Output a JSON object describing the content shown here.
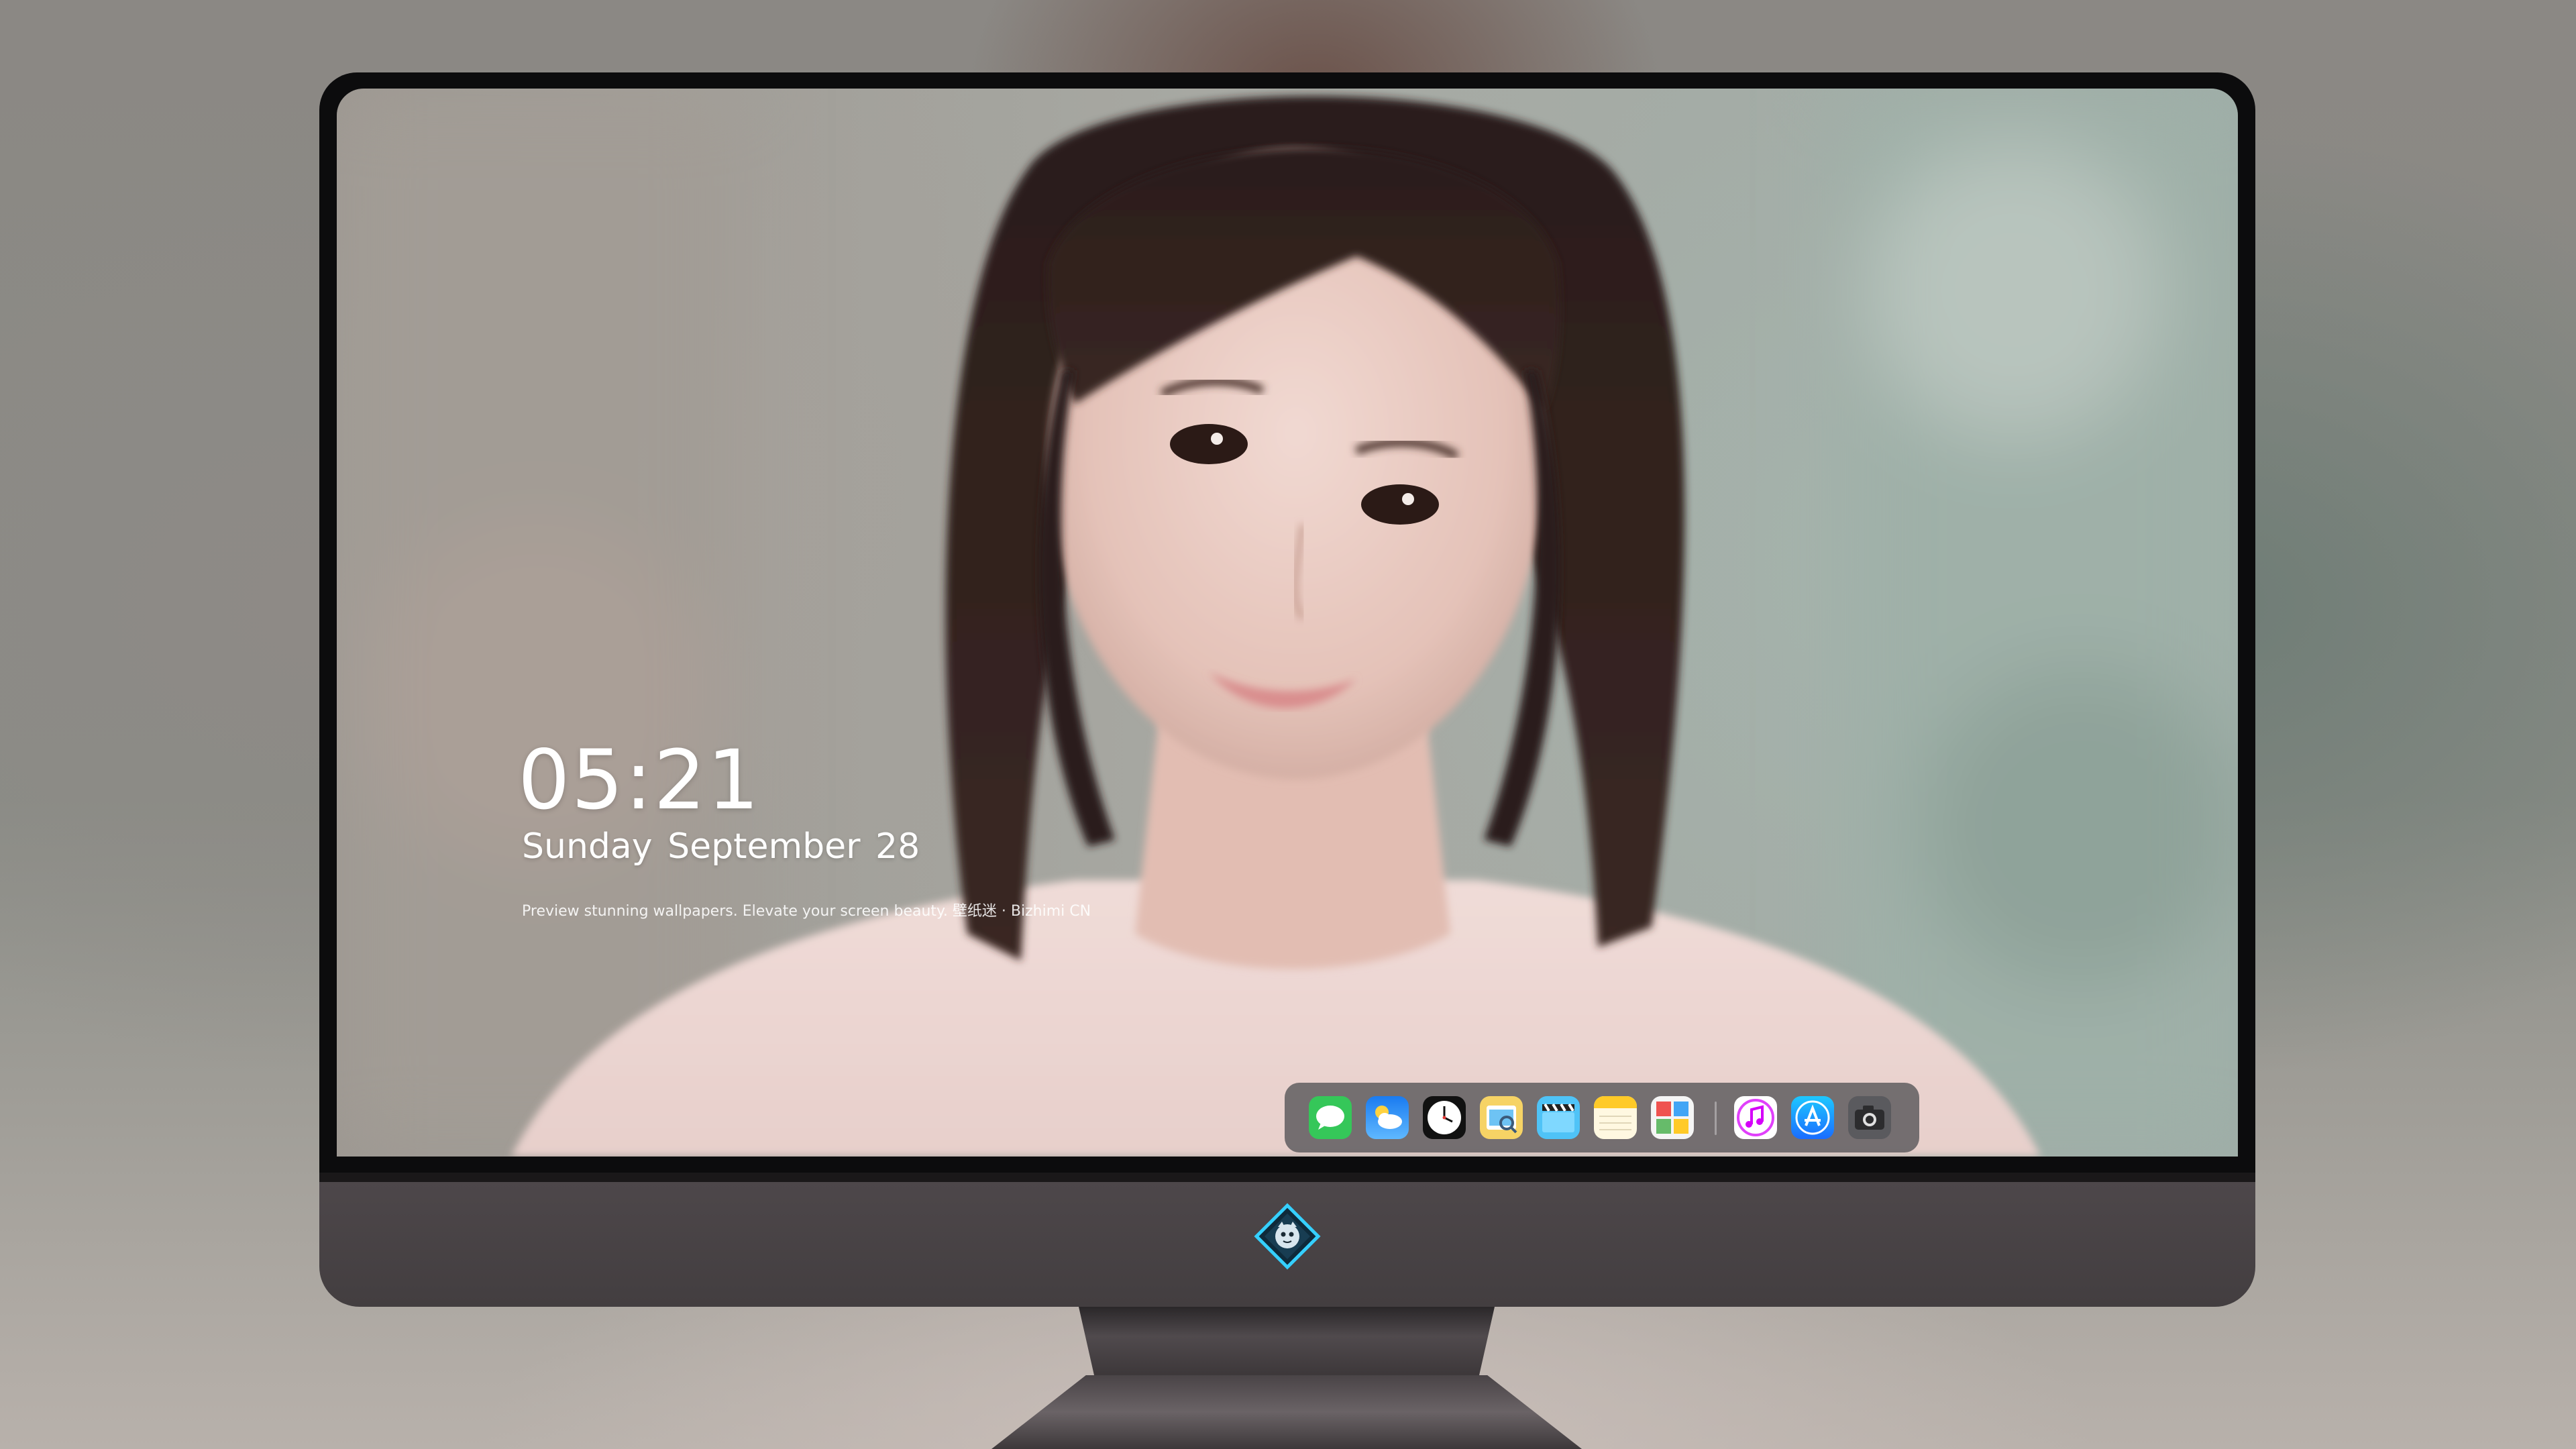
{
  "lock_screen": {
    "time": "05:21",
    "date": "Sunday September  28",
    "tagline": "Preview stunning wallpapers. Elevate your screen beauty. 壁纸迷 · Bizhimi CN"
  },
  "dock": {
    "apps": [
      {
        "icon": "messages-icon",
        "color": "#35c759"
      },
      {
        "icon": "weather-icon",
        "color": "#1e90ff"
      },
      {
        "icon": "clock-icon",
        "color": "#111111"
      },
      {
        "icon": "preview-icon",
        "color": "#f5c242"
      },
      {
        "icon": "video-clapper-icon",
        "color": "#4fc3f7"
      },
      {
        "icon": "notes-icon",
        "color": "#ffd54f"
      },
      {
        "icon": "photo-gallery-icon",
        "color": "#ffffff"
      },
      {
        "icon": "music-icon",
        "color": "#e040fb"
      },
      {
        "icon": "app-store-icon",
        "color": "#1a8cff"
      },
      {
        "icon": "camera-icon",
        "color": "#3a3a3c"
      }
    ]
  },
  "colors": {
    "bezel": "#0c0c0d",
    "chin": "#4d474a",
    "dock_bg": "#46484c"
  }
}
